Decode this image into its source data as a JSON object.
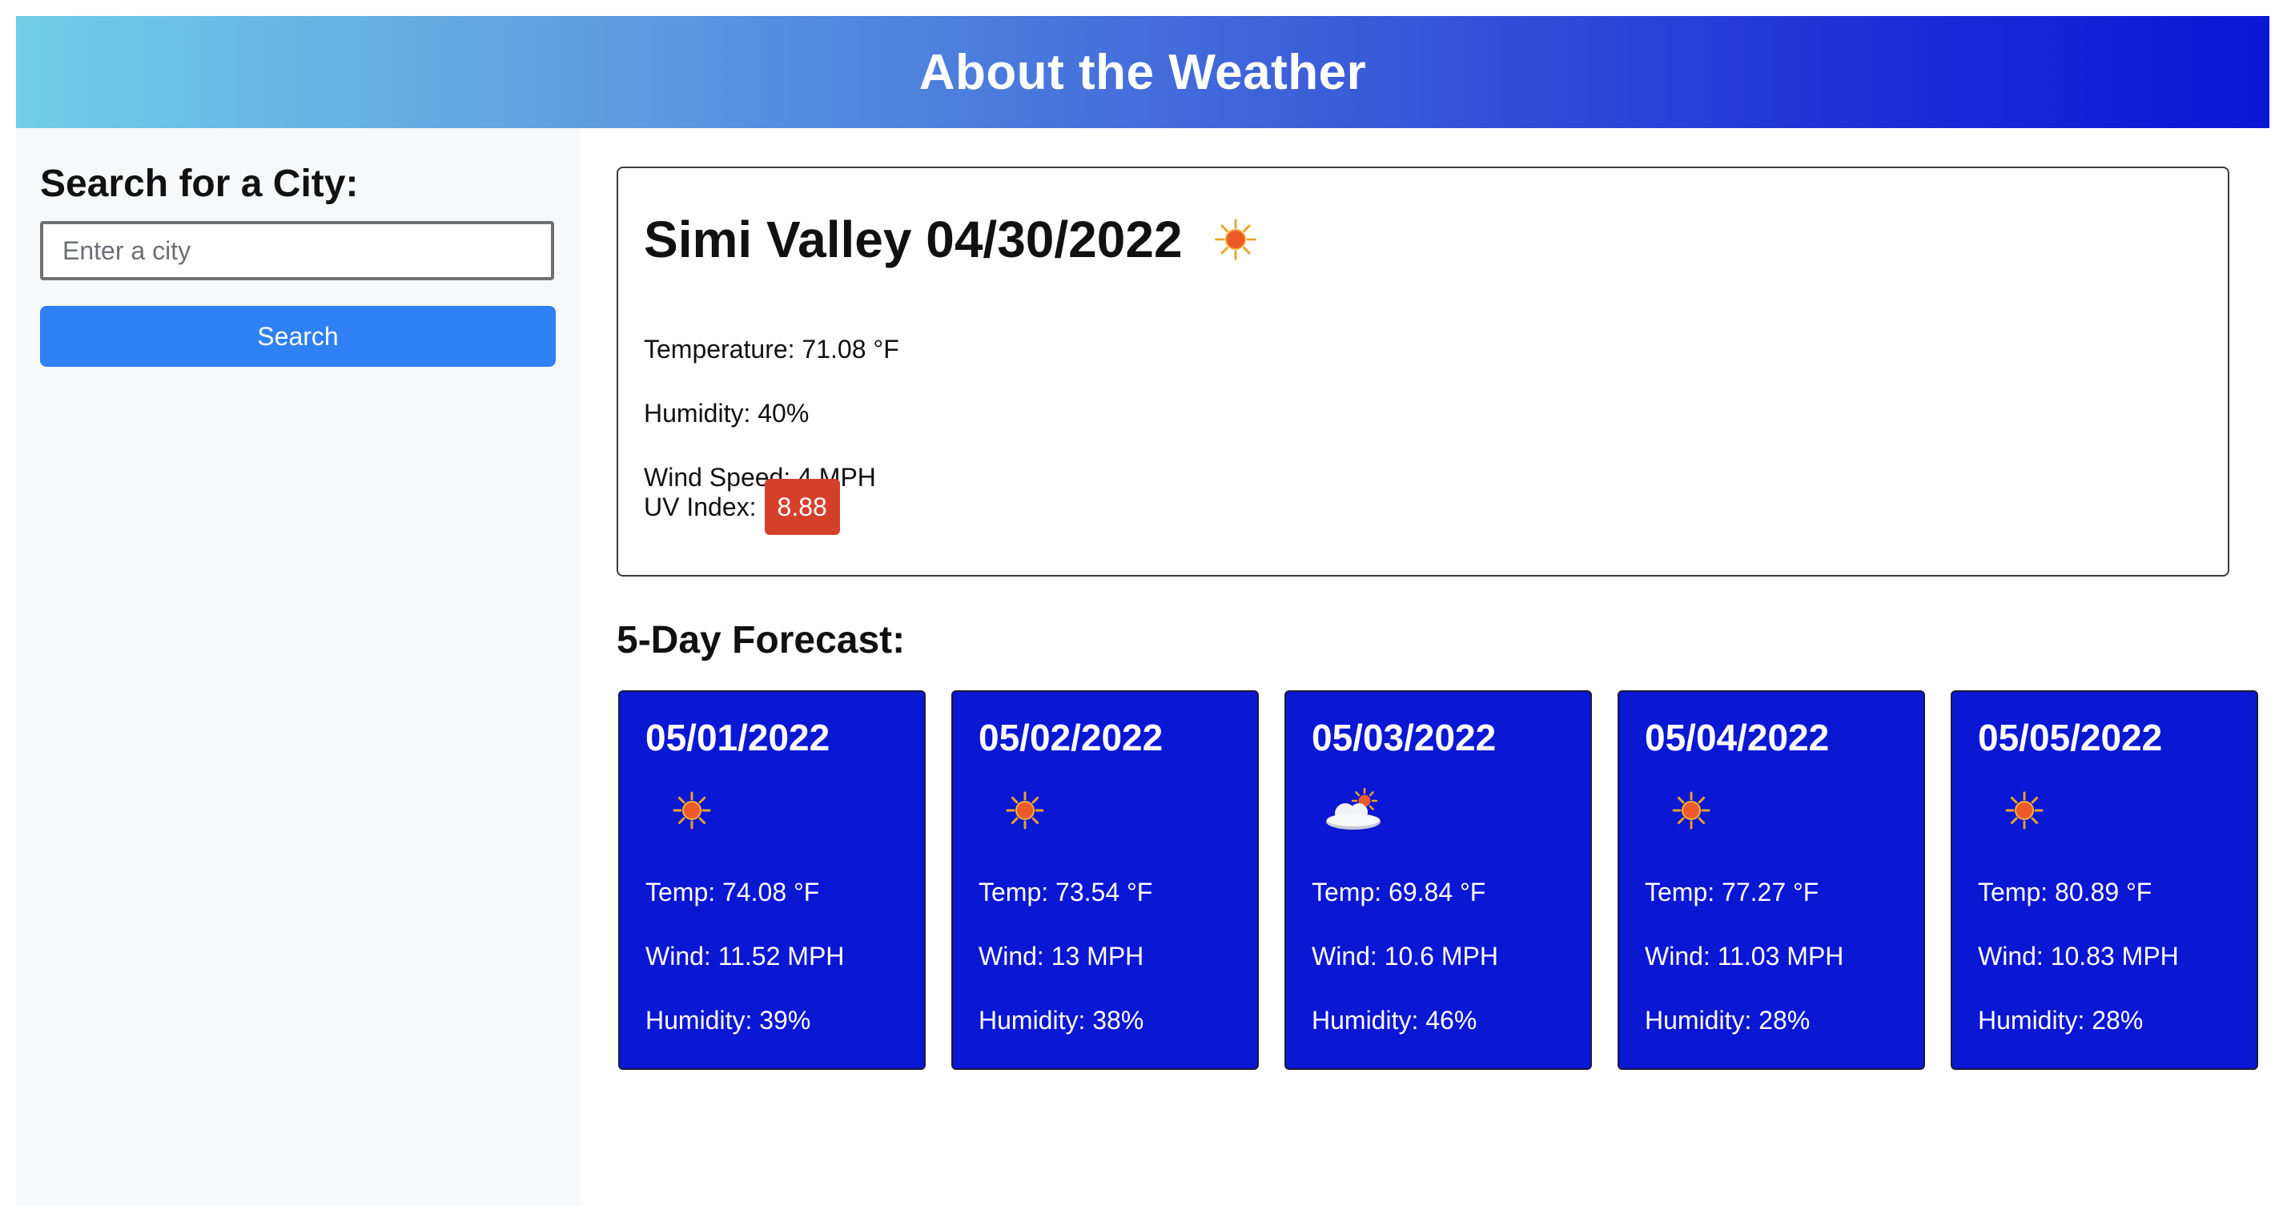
{
  "header": {
    "title": "About the Weather"
  },
  "sidebar": {
    "heading": "Search for a City:",
    "search_input": {
      "value": "",
      "placeholder": "Enter a city"
    },
    "search_button_label": "Search"
  },
  "current": {
    "title": "Simi Valley 04/30/2022",
    "icon": "sun-icon",
    "temperature": "Temperature: 71.08 °F",
    "humidity": "Humidity: 40%",
    "wind": "Wind Speed: 4 MPH",
    "uv_label": "UV Index:",
    "uv_value": "8.88",
    "uv_color": "#d5402b"
  },
  "forecast": {
    "heading": "5-Day Forecast:",
    "card_color": "#0a17d3",
    "days": [
      {
        "date": "05/01/2022",
        "icon": "sun-icon",
        "temp": "Temp: 74.08 °F",
        "wind": "Wind: 11.52 MPH",
        "humidity": "Humidity: 39%"
      },
      {
        "date": "05/02/2022",
        "icon": "sun-icon",
        "temp": "Temp: 73.54 °F",
        "wind": "Wind: 13 MPH",
        "humidity": "Humidity: 38%"
      },
      {
        "date": "05/03/2022",
        "icon": "cloud-sun-icon",
        "temp": "Temp: 69.84 °F",
        "wind": "Wind: 10.6 MPH",
        "humidity": "Humidity: 46%"
      },
      {
        "date": "05/04/2022",
        "icon": "sun-icon",
        "temp": "Temp: 77.27 °F",
        "wind": "Wind: 11.03 MPH",
        "humidity": "Humidity: 28%"
      },
      {
        "date": "05/05/2022",
        "icon": "sun-icon",
        "temp": "Temp: 80.89 °F",
        "wind": "Wind: 10.83 MPH",
        "humidity": "Humidity: 28%"
      }
    ]
  }
}
